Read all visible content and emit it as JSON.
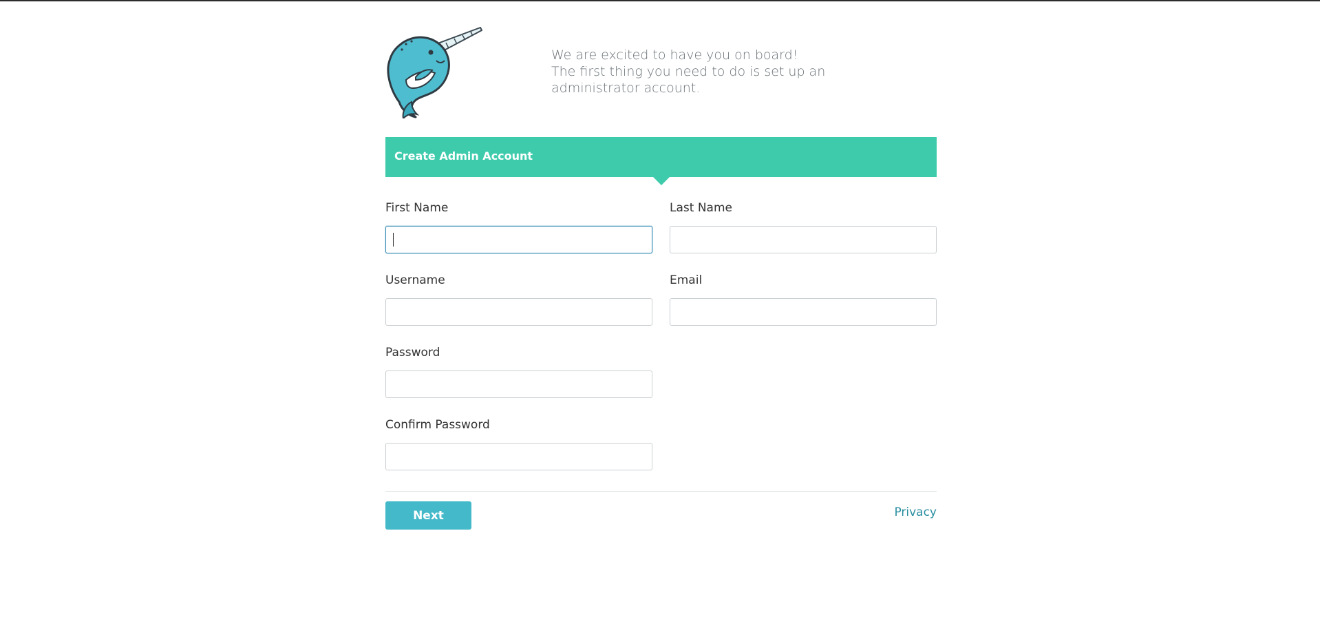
{
  "welcome": {
    "line1": "We are excited to have you on board!",
    "line2": "The first thing you need to do is set up an",
    "line3": "administrator account."
  },
  "logo": {
    "icon": "narwhal-logo-icon"
  },
  "banner": {
    "title": "Create Admin Account"
  },
  "form": {
    "first_name": {
      "label": "First Name",
      "value": "",
      "placeholder": ""
    },
    "last_name": {
      "label": "Last Name",
      "value": "",
      "placeholder": ""
    },
    "username": {
      "label": "Username",
      "value": "",
      "placeholder": ""
    },
    "email": {
      "label": "Email",
      "value": "",
      "placeholder": ""
    },
    "password": {
      "label": "Password",
      "value": "",
      "placeholder": ""
    },
    "confirm_password": {
      "label": "Confirm Password",
      "value": "",
      "placeholder": ""
    }
  },
  "actions": {
    "next_label": "Next",
    "privacy_label": "Privacy"
  },
  "colors": {
    "banner": "#3ecbac",
    "button": "#44b9c9",
    "link": "#2a8ea0",
    "focus_border": "#3a8fb7"
  }
}
